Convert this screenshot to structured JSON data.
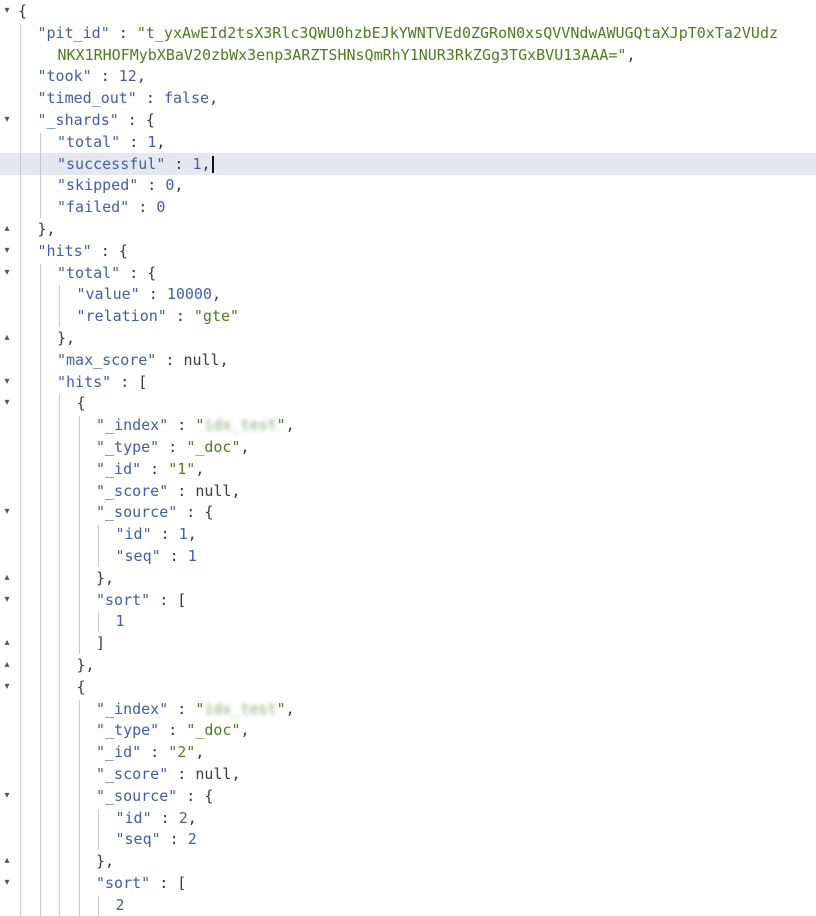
{
  "editor": {
    "lines": [
      {
        "fold": "▾",
        "indent": 0,
        "parts": [
          {
            "t": "{",
            "c": "punct"
          }
        ]
      },
      {
        "fold": "",
        "indent": 1,
        "parts": [
          {
            "t": "\"pit_id\"",
            "c": "key"
          },
          {
            "t": " : ",
            "c": "punct"
          },
          {
            "t": "\"t_yxAwEId2tsX3Rlc3QWU0hzbEJkYWNTVEd0ZGRoN0xsQVVNdwAWUGQtaXJpT0xTa2VUdz",
            "c": "str"
          }
        ]
      },
      {
        "fold": "",
        "indent": 1,
        "cont": true,
        "parts": [
          {
            "t": "NKX1RHOFMybXBaV20zbWx3enp3ARZTSHNsQmRhY1NUR3RkZGg3TGxBVU13AAA=\"",
            "c": "str"
          },
          {
            "t": ",",
            "c": "punct"
          }
        ]
      },
      {
        "fold": "",
        "indent": 1,
        "parts": [
          {
            "t": "\"took\"",
            "c": "key"
          },
          {
            "t": " : ",
            "c": "punct"
          },
          {
            "t": "12",
            "c": "num"
          },
          {
            "t": ",",
            "c": "punct"
          }
        ]
      },
      {
        "fold": "",
        "indent": 1,
        "parts": [
          {
            "t": "\"timed_out\"",
            "c": "key"
          },
          {
            "t": " : ",
            "c": "punct"
          },
          {
            "t": "false",
            "c": "bool"
          },
          {
            "t": ",",
            "c": "punct"
          }
        ]
      },
      {
        "fold": "▾",
        "indent": 1,
        "parts": [
          {
            "t": "\"_shards\"",
            "c": "key"
          },
          {
            "t": " : {",
            "c": "punct"
          }
        ]
      },
      {
        "fold": "",
        "indent": 2,
        "parts": [
          {
            "t": "\"total\"",
            "c": "key"
          },
          {
            "t": " : ",
            "c": "punct"
          },
          {
            "t": "1",
            "c": "num"
          },
          {
            "t": ",",
            "c": "punct"
          }
        ]
      },
      {
        "fold": "",
        "indent": 2,
        "active": true,
        "cursor": true,
        "parts": [
          {
            "t": "\"successful\"",
            "c": "key"
          },
          {
            "t": " : ",
            "c": "punct"
          },
          {
            "t": "1",
            "c": "num"
          },
          {
            "t": ",",
            "c": "punct"
          }
        ]
      },
      {
        "fold": "",
        "indent": 2,
        "parts": [
          {
            "t": "\"skipped\"",
            "c": "key"
          },
          {
            "t": " : ",
            "c": "punct"
          },
          {
            "t": "0",
            "c": "num"
          },
          {
            "t": ",",
            "c": "punct"
          }
        ]
      },
      {
        "fold": "",
        "indent": 2,
        "parts": [
          {
            "t": "\"failed\"",
            "c": "key"
          },
          {
            "t": " : ",
            "c": "punct"
          },
          {
            "t": "0",
            "c": "num"
          }
        ]
      },
      {
        "fold": "▴",
        "indent": 1,
        "parts": [
          {
            "t": "},",
            "c": "punct"
          }
        ]
      },
      {
        "fold": "▾",
        "indent": 1,
        "parts": [
          {
            "t": "\"hits\"",
            "c": "key"
          },
          {
            "t": " : {",
            "c": "punct"
          }
        ]
      },
      {
        "fold": "▾",
        "indent": 2,
        "parts": [
          {
            "t": "\"total\"",
            "c": "key"
          },
          {
            "t": " : {",
            "c": "punct"
          }
        ]
      },
      {
        "fold": "",
        "indent": 3,
        "parts": [
          {
            "t": "\"value\"",
            "c": "key"
          },
          {
            "t": " : ",
            "c": "punct"
          },
          {
            "t": "10000",
            "c": "num"
          },
          {
            "t": ",",
            "c": "punct"
          }
        ]
      },
      {
        "fold": "",
        "indent": 3,
        "parts": [
          {
            "t": "\"relation\"",
            "c": "key"
          },
          {
            "t": " : ",
            "c": "punct"
          },
          {
            "t": "\"gte\"",
            "c": "str"
          }
        ]
      },
      {
        "fold": "▴",
        "indent": 2,
        "parts": [
          {
            "t": "},",
            "c": "punct"
          }
        ]
      },
      {
        "fold": "",
        "indent": 2,
        "parts": [
          {
            "t": "\"max_score\"",
            "c": "key"
          },
          {
            "t": " : ",
            "c": "punct"
          },
          {
            "t": "null",
            "c": "null"
          },
          {
            "t": ",",
            "c": "punct"
          }
        ]
      },
      {
        "fold": "▾",
        "indent": 2,
        "parts": [
          {
            "t": "\"hits\"",
            "c": "key"
          },
          {
            "t": " : [",
            "c": "punct"
          }
        ]
      },
      {
        "fold": "▾",
        "indent": 3,
        "parts": [
          {
            "t": "{",
            "c": "punct"
          }
        ]
      },
      {
        "fold": "",
        "indent": 4,
        "parts": [
          {
            "t": "\"_index\"",
            "c": "key"
          },
          {
            "t": " : ",
            "c": "punct"
          },
          {
            "t": "\"",
            "c": "str"
          },
          {
            "t": "idx_test",
            "c": "blur"
          },
          {
            "t": "\"",
            "c": "str"
          },
          {
            "t": ",",
            "c": "punct"
          }
        ]
      },
      {
        "fold": "",
        "indent": 4,
        "parts": [
          {
            "t": "\"_type\"",
            "c": "key"
          },
          {
            "t": " : ",
            "c": "punct"
          },
          {
            "t": "\"_doc\"",
            "c": "str"
          },
          {
            "t": ",",
            "c": "punct"
          }
        ]
      },
      {
        "fold": "",
        "indent": 4,
        "parts": [
          {
            "t": "\"_id\"",
            "c": "key"
          },
          {
            "t": " : ",
            "c": "punct"
          },
          {
            "t": "\"1\"",
            "c": "str"
          },
          {
            "t": ",",
            "c": "punct"
          }
        ]
      },
      {
        "fold": "",
        "indent": 4,
        "parts": [
          {
            "t": "\"_score\"",
            "c": "key"
          },
          {
            "t": " : ",
            "c": "punct"
          },
          {
            "t": "null",
            "c": "null"
          },
          {
            "t": ",",
            "c": "punct"
          }
        ]
      },
      {
        "fold": "▾",
        "indent": 4,
        "parts": [
          {
            "t": "\"_source\"",
            "c": "key"
          },
          {
            "t": " : {",
            "c": "punct"
          }
        ]
      },
      {
        "fold": "",
        "indent": 5,
        "parts": [
          {
            "t": "\"id\"",
            "c": "key"
          },
          {
            "t": " : ",
            "c": "punct"
          },
          {
            "t": "1",
            "c": "num"
          },
          {
            "t": ",",
            "c": "punct"
          }
        ]
      },
      {
        "fold": "",
        "indent": 5,
        "parts": [
          {
            "t": "\"seq\"",
            "c": "key"
          },
          {
            "t": " : ",
            "c": "punct"
          },
          {
            "t": "1",
            "c": "num"
          }
        ]
      },
      {
        "fold": "▴",
        "indent": 4,
        "parts": [
          {
            "t": "},",
            "c": "punct"
          }
        ]
      },
      {
        "fold": "▾",
        "indent": 4,
        "parts": [
          {
            "t": "\"sort\"",
            "c": "key"
          },
          {
            "t": " : [",
            "c": "punct"
          }
        ]
      },
      {
        "fold": "",
        "indent": 5,
        "parts": [
          {
            "t": "1",
            "c": "num"
          }
        ]
      },
      {
        "fold": "▴",
        "indent": 4,
        "parts": [
          {
            "t": "]",
            "c": "punct"
          }
        ]
      },
      {
        "fold": "▴",
        "indent": 3,
        "parts": [
          {
            "t": "},",
            "c": "punct"
          }
        ]
      },
      {
        "fold": "▾",
        "indent": 3,
        "parts": [
          {
            "t": "{",
            "c": "punct"
          }
        ]
      },
      {
        "fold": "",
        "indent": 4,
        "parts": [
          {
            "t": "\"_index\"",
            "c": "key"
          },
          {
            "t": " : ",
            "c": "punct"
          },
          {
            "t": "\"",
            "c": "str"
          },
          {
            "t": "idx_test",
            "c": "blur"
          },
          {
            "t": "\"",
            "c": "str"
          },
          {
            "t": ",",
            "c": "punct"
          }
        ]
      },
      {
        "fold": "",
        "indent": 4,
        "parts": [
          {
            "t": "\"_type\"",
            "c": "key"
          },
          {
            "t": " : ",
            "c": "punct"
          },
          {
            "t": "\"_doc\"",
            "c": "str"
          },
          {
            "t": ",",
            "c": "punct"
          }
        ]
      },
      {
        "fold": "",
        "indent": 4,
        "parts": [
          {
            "t": "\"_id\"",
            "c": "key"
          },
          {
            "t": " : ",
            "c": "punct"
          },
          {
            "t": "\"2\"",
            "c": "str"
          },
          {
            "t": ",",
            "c": "punct"
          }
        ]
      },
      {
        "fold": "",
        "indent": 4,
        "parts": [
          {
            "t": "\"_score\"",
            "c": "key"
          },
          {
            "t": " : ",
            "c": "punct"
          },
          {
            "t": "null",
            "c": "null"
          },
          {
            "t": ",",
            "c": "punct"
          }
        ]
      },
      {
        "fold": "▾",
        "indent": 4,
        "parts": [
          {
            "t": "\"_source\"",
            "c": "key"
          },
          {
            "t": " : {",
            "c": "punct"
          }
        ]
      },
      {
        "fold": "",
        "indent": 5,
        "parts": [
          {
            "t": "\"id\"",
            "c": "key"
          },
          {
            "t": " : ",
            "c": "punct"
          },
          {
            "t": "2",
            "c": "num"
          },
          {
            "t": ",",
            "c": "punct"
          }
        ]
      },
      {
        "fold": "",
        "indent": 5,
        "parts": [
          {
            "t": "\"seq\"",
            "c": "key"
          },
          {
            "t": " : ",
            "c": "punct"
          },
          {
            "t": "2",
            "c": "num"
          }
        ]
      },
      {
        "fold": "▴",
        "indent": 4,
        "parts": [
          {
            "t": "},",
            "c": "punct"
          }
        ]
      },
      {
        "fold": "▾",
        "indent": 4,
        "parts": [
          {
            "t": "\"sort\"",
            "c": "key"
          },
          {
            "t": " : [",
            "c": "punct"
          }
        ]
      },
      {
        "fold": "",
        "indent": 5,
        "parts": [
          {
            "t": "2",
            "c": "num"
          }
        ]
      }
    ]
  }
}
